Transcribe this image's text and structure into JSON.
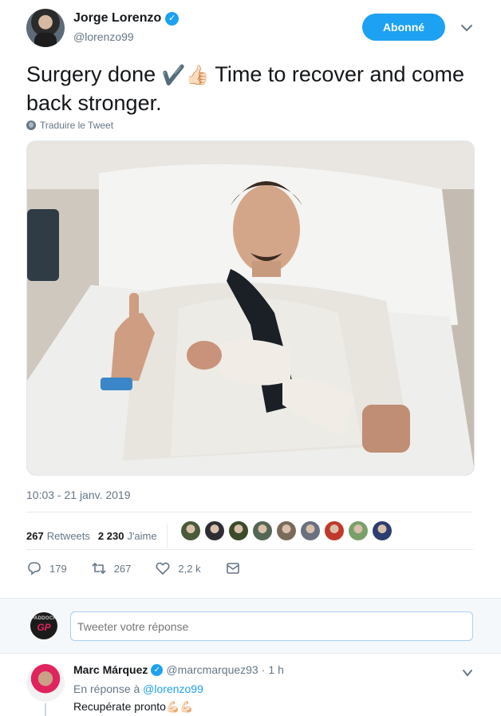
{
  "author": {
    "display_name": "Jorge Lorenzo",
    "handle": "@lorenzo99",
    "verified_glyph": "✓"
  },
  "follow_button": {
    "label": "Abonné",
    "color": "#1da1f2"
  },
  "tweet": {
    "text_part1": "Surgery done ",
    "emoji1": "✔️",
    "emoji2": "👍🏻",
    "text_part2": " Time to recover and come back stronger.",
    "translate_label": "Traduire le Tweet",
    "timestamp": "10:03 - 21 janv. 2019"
  },
  "stats": {
    "retweets_count": "267",
    "retweets_label": "Retweets",
    "likes_count": "2 230",
    "likes_label": "J'aime",
    "liker_colors": [
      "#4a5a3a",
      "#2d2d35",
      "#3a4a2a",
      "#556655",
      "#7a6a5a",
      "#6a7080",
      "#c0392b",
      "#7aa06a",
      "#2c3e70"
    ]
  },
  "actions": {
    "reply": {
      "icon": "reply-icon",
      "count": "179"
    },
    "retweet": {
      "icon": "retweet-icon",
      "count": "267"
    },
    "like": {
      "icon": "heart-icon",
      "count": "2,2 k"
    },
    "dm": {
      "icon": "envelope-icon"
    }
  },
  "reply_box": {
    "placeholder": "Tweeter votre réponse",
    "avatar_top": "PADDOCK",
    "avatar_main": "GP"
  },
  "reply": {
    "display_name": "Marc Márquez",
    "verified_glyph": "✓",
    "handle": "@marcmarquez93",
    "dot": "·",
    "time": "1 h",
    "context_prefix": "En réponse à ",
    "context_mention": "@lorenzo99",
    "text": "Recupérate pronto",
    "emoji": "💪🏻💪🏻"
  },
  "colors": {
    "accent": "#1da1f2",
    "muted": "#657786",
    "text": "#14171a"
  }
}
